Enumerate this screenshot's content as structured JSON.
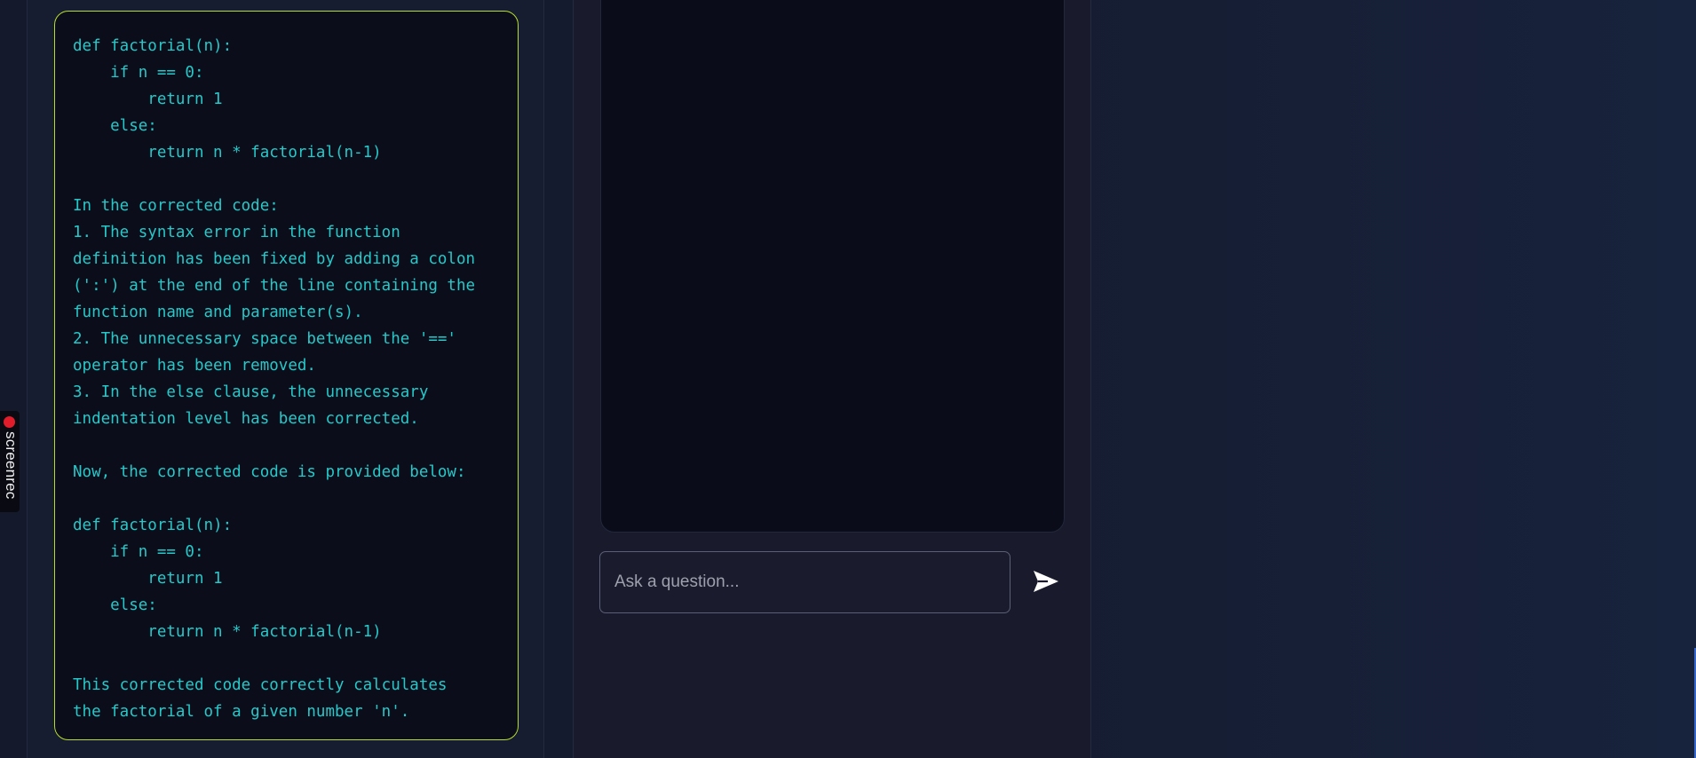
{
  "response": {
    "lines": [
      "def factorial(n):",
      "    if n == 0:",
      "        return 1",
      "    else:",
      "        return n * factorial(n-1)",
      "",
      "In the corrected code:",
      "1. The syntax error in the function",
      "definition has been fixed by adding a colon",
      "(':') at the end of the line containing the",
      "function name and parameter(s).",
      "2. The unnecessary space between the '=='",
      "operator has been removed.",
      "3. In the else clause, the unnecessary",
      "indentation level has been corrected.",
      "",
      "Now, the corrected code is provided below:",
      "",
      "def factorial(n):",
      "    if n == 0:",
      "        return 1",
      "    else:",
      "        return n * factorial(n-1)",
      "",
      "This corrected code correctly calculates",
      "the factorial of a given number 'n'."
    ]
  },
  "chat": {
    "input_placeholder": "Ask a question...",
    "input_value": "",
    "send_icon": "send-arrow-icon"
  },
  "recorder": {
    "label": "screenrec",
    "dot_icon": "record-dot-icon"
  },
  "colors": {
    "code_text": "#25c9c9",
    "card_border": "#b7dd2c",
    "card_bg": "#0b0d1a",
    "page_bg": "#141a2c",
    "record_dot": "#e11d2b"
  }
}
